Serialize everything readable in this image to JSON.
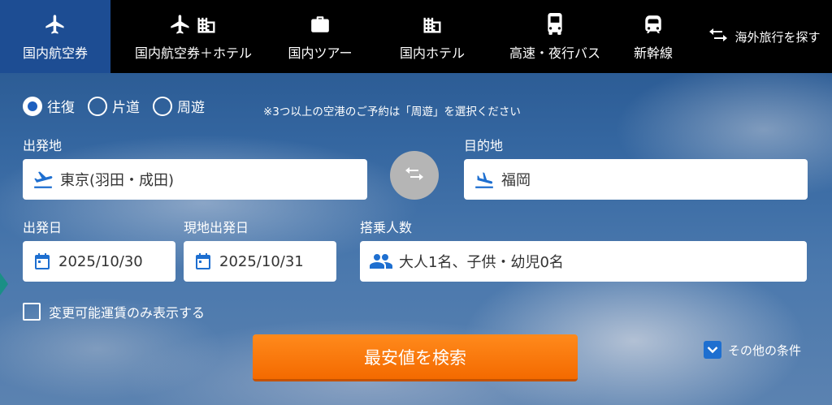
{
  "nav": {
    "tabs": [
      {
        "label": "国内航空券",
        "icon": "airplane-icon",
        "active": true
      },
      {
        "label": "国内航空券＋ホテル",
        "icon": "airplane-hotel-icon",
        "active": false
      },
      {
        "label": "国内ツアー",
        "icon": "suitcase-icon",
        "active": false
      },
      {
        "label": "国内ホテル",
        "icon": "hotel-icon",
        "active": false
      },
      {
        "label": "高速・夜行バス",
        "icon": "bus-icon",
        "active": false
      },
      {
        "label": "新幹線",
        "icon": "train-icon",
        "active": false
      }
    ],
    "overseas": {
      "label": "海外旅行を探す",
      "icon": "swap-arrows-icon"
    }
  },
  "trip_type": {
    "options": [
      {
        "label": "往復",
        "checked": true
      },
      {
        "label": "片道",
        "checked": false
      },
      {
        "label": "周遊",
        "checked": false
      }
    ],
    "note": "※3つ以上の空港のご予約は「周遊」を選択ください"
  },
  "route": {
    "departure_label": "出発地",
    "departure_value": "東京(羽田・成田)",
    "destination_label": "目的地",
    "destination_value": "福岡"
  },
  "dates": {
    "departure_label": "出発日",
    "departure_value": "2025/10/30",
    "return_label": "現地出発日",
    "return_value": "2025/10/31"
  },
  "passengers": {
    "label": "搭乗人数",
    "value": "大人1名、子供・幼児0名"
  },
  "options": {
    "changeable_fare_label": "変更可能運賃のみ表示する",
    "changeable_fare_checked": false
  },
  "search": {
    "button_label": "最安値を検索",
    "more_conditions_label": "その他の条件"
  },
  "colors": {
    "accent": "#f46a00",
    "active_tab": "#1d4d93",
    "icon_blue": "#1e6fd0"
  }
}
